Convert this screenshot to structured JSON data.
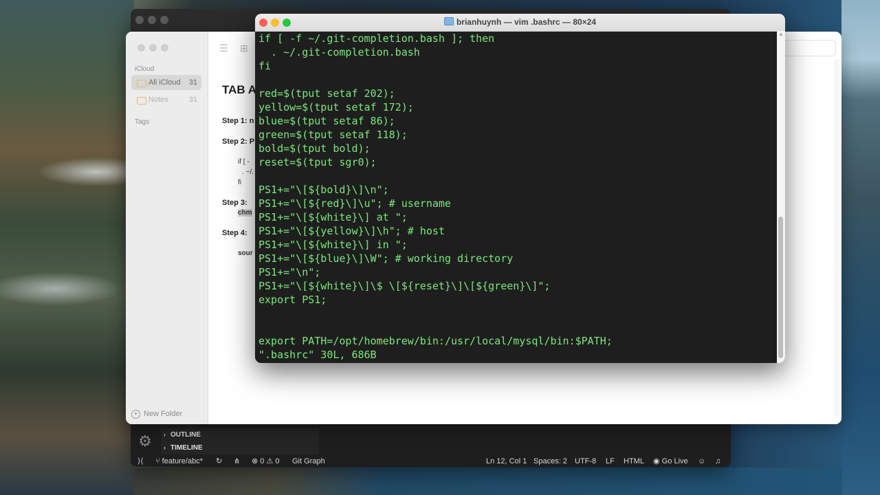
{
  "vscode": {
    "outline_label": "OUTLINE",
    "timeline_label": "TIMELINE",
    "status": {
      "branch": "feature/abc*",
      "errors": "0",
      "warnings": "0",
      "git_graph": "Git Graph",
      "position": "Ln 12, Col 1",
      "spaces": "Spaces: 2",
      "encoding": "UTF-8",
      "eol": "LF",
      "language": "HTML",
      "go_live": "Go Live"
    }
  },
  "notes": {
    "section_icloud": "iCloud",
    "folders": [
      {
        "label": "All iCloud",
        "count": "31"
      },
      {
        "label": "Notes",
        "count": "31"
      }
    ],
    "section_tags": "Tags",
    "new_folder": "New Folder",
    "heading": "TAB A",
    "step1": "Step 1: n",
    "step2": "Step 2: P",
    "code_if": "if [ -",
    "code_dot": ". ~/.",
    "code_fi": "fi",
    "step3": "Step 3:",
    "code_chm": "chm",
    "step4": "Step 4:",
    "code_sour": "sour"
  },
  "terminal": {
    "title": "brianhuynh — vim .bashrc — 80×24",
    "lines": [
      "if [ -f ~/.git-completion.bash ]; then",
      "  . ~/.git-completion.bash",
      "fi",
      "",
      "red=$(tput setaf 202);",
      "yellow=$(tput setaf 172);",
      "blue=$(tput setaf 86);",
      "green=$(tput setaf 118);",
      "bold=$(tput bold);",
      "reset=$(tput sgr0);",
      "",
      "PS1+=\"\\[${bold}\\]\\n\";",
      "PS1+=\"\\[${red}\\]\\u\"; # username",
      "PS1+=\"\\[${white}\\] at \";",
      "PS1+=\"\\[${yellow}\\]\\h\"; # host",
      "PS1+=\"\\[${white}\\] in \";",
      "PS1+=\"\\[${blue}\\]\\W\"; # working directory",
      "PS1+=\"\\n\";",
      "PS1+=\"\\[${white}\\]\\$ \\[${reset}\\]\\[${green}\\]\";",
      "export PS1;",
      "",
      "",
      "export PATH=/opt/homebrew/bin:/usr/local/mysql/bin:$PATH;",
      "\".bashrc\" 30L, 686B"
    ]
  },
  "colors": {
    "terminal_text": "#7ce87c",
    "terminal_bg": "#1e1e1e",
    "close": "#ff5f57",
    "minimize": "#febc2e",
    "zoom": "#28c840"
  }
}
